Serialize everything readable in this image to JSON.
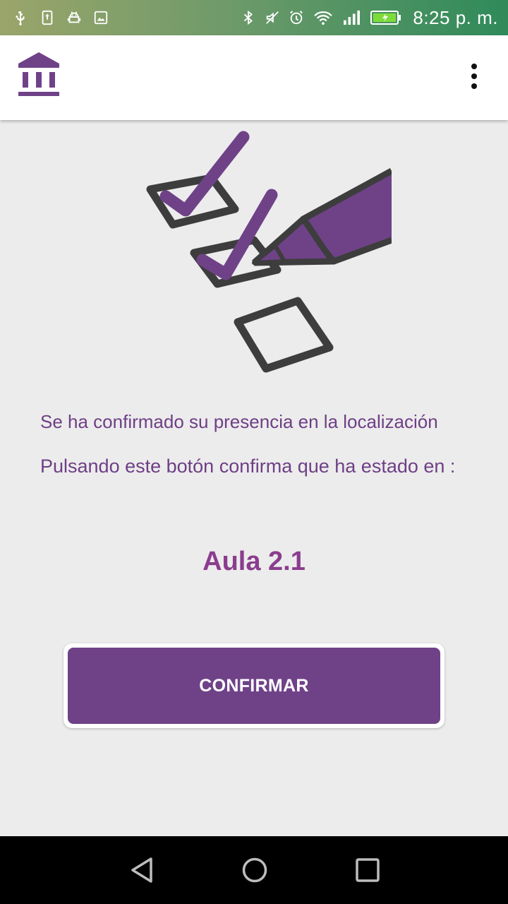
{
  "status_bar": {
    "time": "8:25 p. m.",
    "left_icons": [
      "usb-icon",
      "upload-icon",
      "android-icon",
      "image-icon"
    ],
    "right_icons": [
      "bluetooth-icon",
      "mute-icon",
      "alarm-icon",
      "wifi-icon",
      "signal-icon",
      "battery-charging-icon"
    ]
  },
  "app_bar": {
    "logo_icon": "institution-icon",
    "menu_icon": "more-vert-icon"
  },
  "illustration": {
    "icon": "checklist-pencil-icon"
  },
  "message": {
    "confirmed": "Se ha confirmado su presencia en la localización",
    "instruction": "Pulsando este botón confirma que ha estado en :"
  },
  "location": {
    "name": "Aula 2.1"
  },
  "confirm_button": {
    "label": "CONFIRMAR"
  },
  "nav_bar": {
    "buttons": [
      "back-icon",
      "home-icon",
      "recents-icon"
    ]
  },
  "colors": {
    "primary": "#6f4288",
    "text_purple": "#6e3f86",
    "location_purple": "#8a3d8e",
    "background": "#ececec"
  }
}
